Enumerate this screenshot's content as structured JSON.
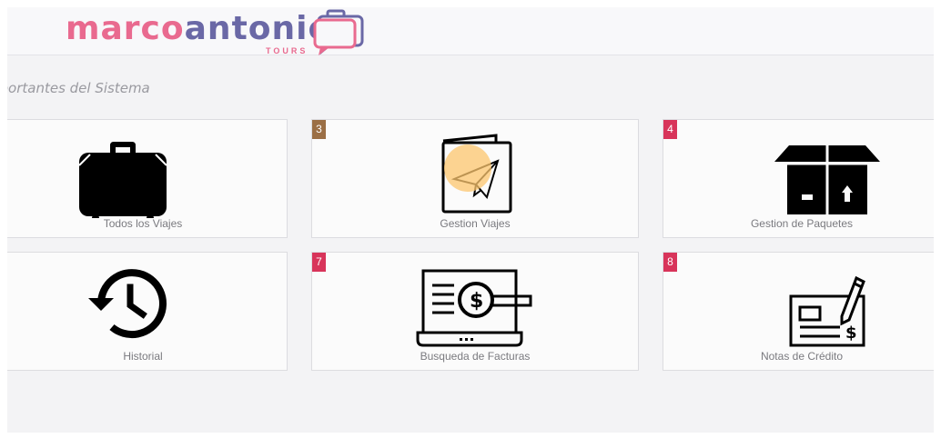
{
  "header": {
    "logo_part1": "marco",
    "logo_part2": "antonio",
    "logo_sub": "TOURS"
  },
  "section_title": "nportantes del Sistema",
  "colors": {
    "brand_pink": "#e96a8f",
    "brand_purple": "#6a68a6",
    "badge_brown": "#9b6f45",
    "badge_red": "#d8345a"
  },
  "cards": [
    {
      "label": "Todos los Viajes",
      "badge": "",
      "icon": "suitcase-icon"
    },
    {
      "label": "Gestion Viajes",
      "badge": "3",
      "icon": "paper-plane-card-icon"
    },
    {
      "label": "Gestion de Paquetes",
      "badge": "4",
      "icon": "package-box-icon"
    },
    {
      "label": "Historial",
      "badge": "",
      "icon": "history-clock-icon"
    },
    {
      "label": "Busqueda de Facturas",
      "badge": "7",
      "icon": "invoice-search-laptop-icon"
    },
    {
      "label": "Notas de Crédito",
      "badge": "8",
      "icon": "check-pen-icon"
    }
  ]
}
